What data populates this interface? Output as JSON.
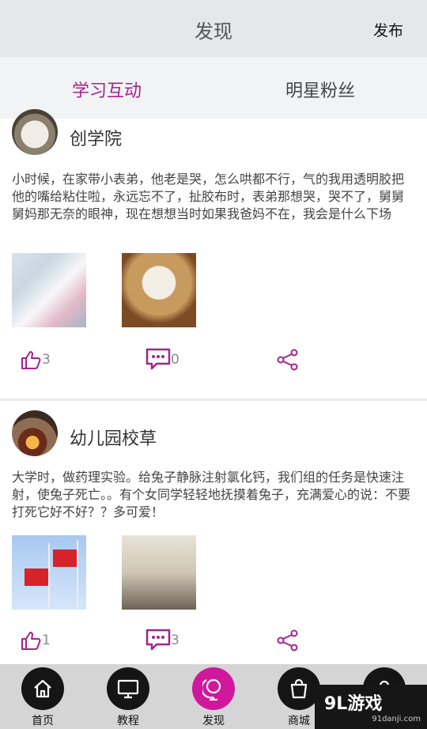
{
  "header": {
    "title": "发现",
    "publish": "发布"
  },
  "tabs": [
    {
      "label": "学习互动",
      "active": true
    },
    {
      "label": "明星粉丝",
      "active": false
    }
  ],
  "posts": [
    {
      "username": "创学院",
      "text": "小时候，在家带小表弟，他老是哭，怎么哄都不行，气的我用透明胶把他的嘴给粘住啦，永远忘不了，扯胶布时，表弟那想哭，哭不了，舅舅舅妈那无奈的眼神，现在想想当时如果我爸妈不在，我会是什么下场",
      "likes": "3",
      "comments": "0"
    },
    {
      "username": "幼儿园校草",
      "text": "大学时，做药理实验。给兔子静脉注射氯化钙，我们组的任务是快速注射，使兔子死亡。。有个女同学轻轻地抚摸着兔子，充满爱心的说：不要打死它好不好？？多可爱！",
      "likes": "1",
      "comments": "3"
    }
  ],
  "tabbar": [
    {
      "label": "首页",
      "icon": "home-icon",
      "active": false
    },
    {
      "label": "教程",
      "icon": "monitor-icon",
      "active": false
    },
    {
      "label": "发现",
      "icon": "globe-icon",
      "active": true
    },
    {
      "label": "商城",
      "icon": "shopping-bag-icon",
      "active": false
    },
    {
      "label": "",
      "icon": "user-icon",
      "active": false
    }
  ],
  "watermark": {
    "logo": "9L游戏",
    "url": "91danji.com"
  },
  "colors": {
    "accent": "#a2248c",
    "active_tab_circle": "#d0189c",
    "header_bg": "#e6e7e9"
  }
}
